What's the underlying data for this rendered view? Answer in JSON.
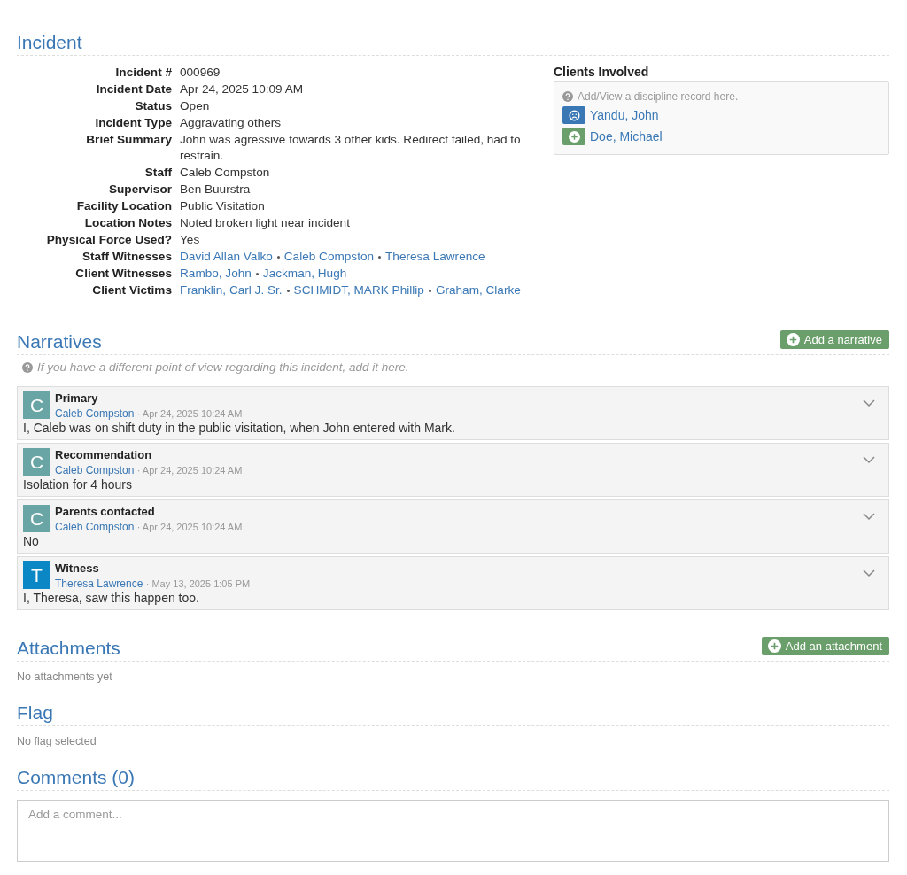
{
  "incident": {
    "title": "Incident",
    "fields": [
      {
        "label": "Incident #",
        "kind": "text",
        "value": "000969"
      },
      {
        "label": "Incident Date",
        "kind": "text",
        "value": "Apr 24, 2025 10:09 AM"
      },
      {
        "label": "Status",
        "kind": "text",
        "value": "Open"
      },
      {
        "label": "Incident Type",
        "kind": "text",
        "value": "Aggravating others"
      },
      {
        "label": "Brief Summary",
        "kind": "text",
        "value": "John was agressive towards 3 other kids. Redirect failed, had to restrain."
      },
      {
        "label": "Staff",
        "kind": "text",
        "value": "Caleb Compston"
      },
      {
        "label": "Supervisor",
        "kind": "text",
        "value": "Ben Buurstra"
      },
      {
        "label": "Facility Location",
        "kind": "text",
        "value": "Public Visitation"
      },
      {
        "label": "Location Notes",
        "kind": "text",
        "value": "Noted broken light near incident"
      },
      {
        "label": "Physical Force Used?",
        "kind": "text",
        "value": "Yes"
      },
      {
        "label": "Staff Witnesses",
        "kind": "links",
        "links": [
          "David Allan Valko",
          "Caleb Compston",
          "Theresa Lawrence"
        ]
      },
      {
        "label": "Client Witnesses",
        "kind": "links",
        "links": [
          "Rambo, John",
          "Jackman, Hugh"
        ]
      },
      {
        "label": "Client Victims",
        "kind": "links",
        "links": [
          "Franklin, Carl J. Sr.",
          "SCHMIDT, MARK Phillip",
          "Graham, Clarke"
        ]
      }
    ],
    "clients": {
      "title": "Clients Involved",
      "hint": "Add/View a discipline record here.",
      "items": [
        {
          "name": "Yandu, John",
          "kind": "frown",
          "color": "#3a78b5"
        },
        {
          "name": "Doe, Michael",
          "kind": "plus",
          "color": "#6a9e6a"
        }
      ]
    }
  },
  "narratives": {
    "title": "Narratives",
    "button": "Add a narrative",
    "hint": "If you have a different point of view regarding this incident, add it here.",
    "items": [
      {
        "initial": "C",
        "color": "#6aa5a5",
        "title": "Primary",
        "author": "Caleb Compston",
        "date": "· Apr 24, 2025 10:24 AM",
        "body": "I, Caleb was on shift duty in the public visitation, when John entered with Mark."
      },
      {
        "initial": "C",
        "color": "#6aa5a5",
        "title": "Recommendation",
        "author": "Caleb Compston",
        "date": "· Apr 24, 2025 10:24 AM",
        "body": "Isolation for 4 hours"
      },
      {
        "initial": "C",
        "color": "#6aa5a5",
        "title": "Parents contacted",
        "author": "Caleb Compston",
        "date": "· Apr 24, 2025 10:24 AM",
        "body": "No"
      },
      {
        "initial": "T",
        "color": "#0a87c4",
        "title": "Witness",
        "author": "Theresa Lawrence",
        "date": "· May 13, 2025 1:05 PM",
        "body": "I, Theresa, saw this happen too."
      }
    ]
  },
  "attachments": {
    "title": "Attachments",
    "button": "Add an attachment",
    "empty": "No attachments yet"
  },
  "flag": {
    "title": "Flag",
    "empty": "No flag selected"
  },
  "comments": {
    "title": "Comments (0)",
    "placeholder": "Add a comment..."
  }
}
